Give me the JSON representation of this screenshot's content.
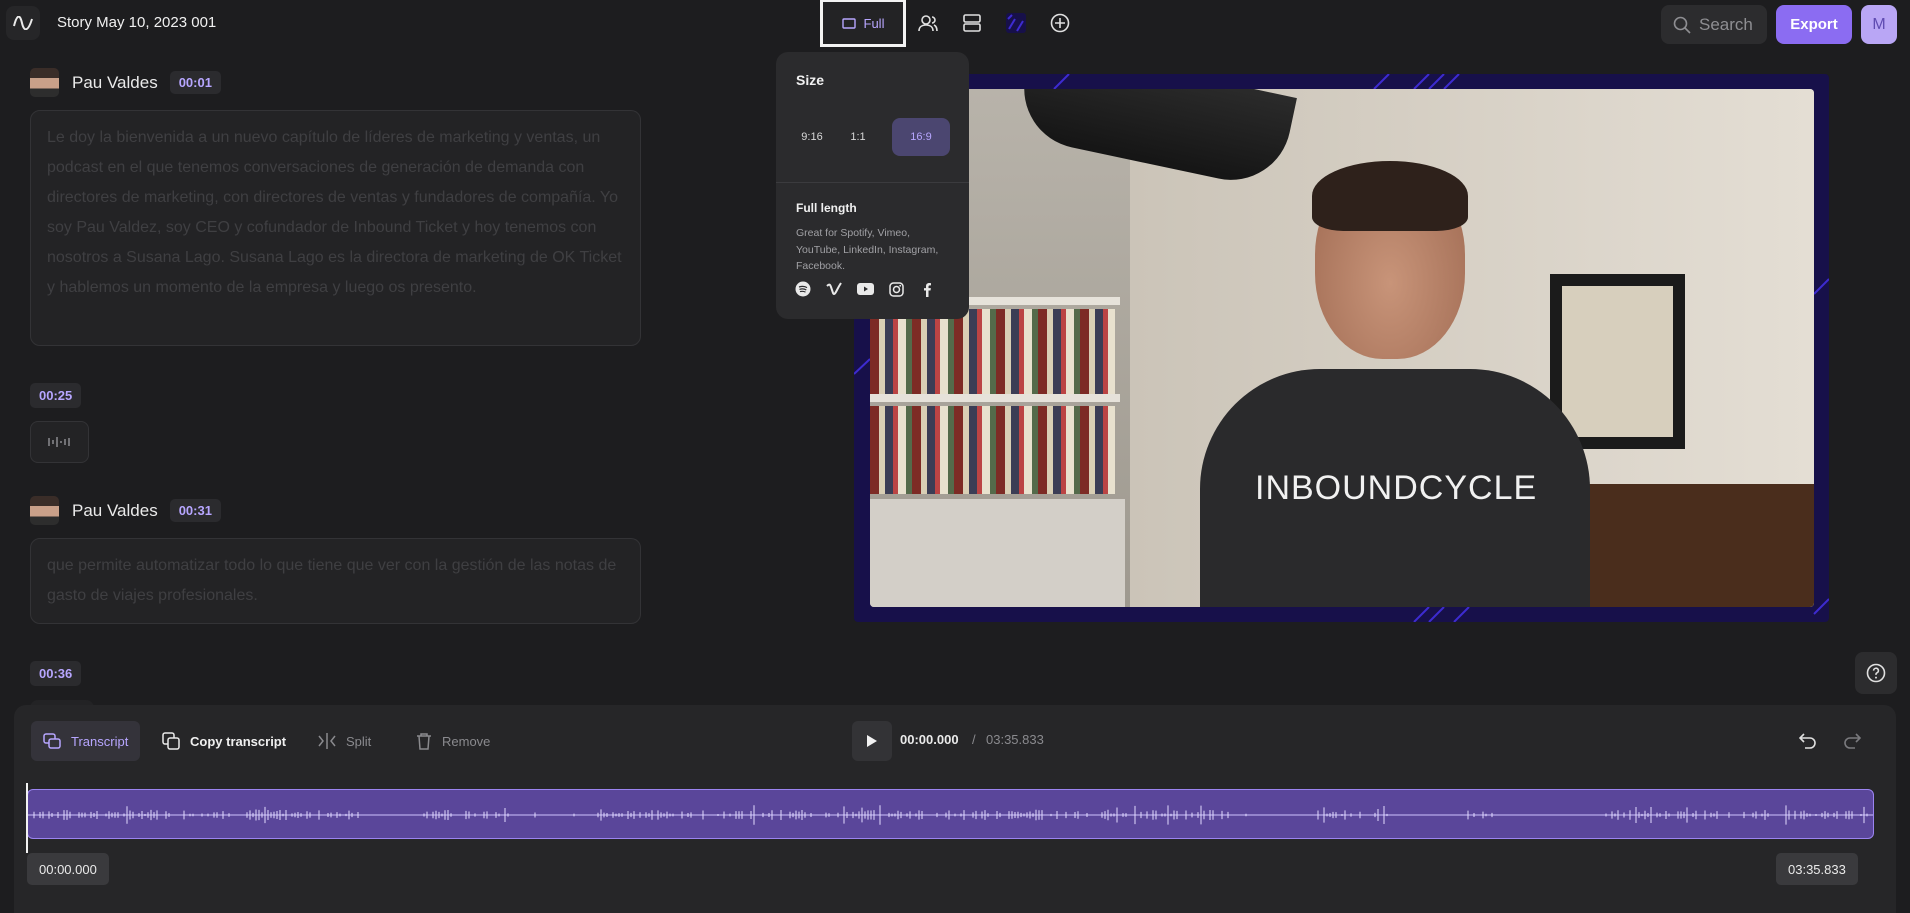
{
  "header": {
    "title": "Story May 10, 2023 001",
    "full_label": "Full",
    "search_placeholder": "Search",
    "export_label": "Export",
    "avatar_initial": "M"
  },
  "transcript": {
    "blocks": [
      {
        "speaker": "Pau Valdes",
        "time": "00:01",
        "text": "Le doy la bienvenida a un nuevo capítulo de líderes de marketing y ventas, un podcast en el que tenemos conversaciones de generación de demanda con directores de marketing, con directores de ventas y fundadores de compañía. Yo soy Pau Valdez, soy CEO y cofundador de Inbound Ticket y hoy tenemos con nosotros a Susana Lago. Susana Lago es la directora de marketing de OK Ticket y hablemos un momento de la empresa y luego os presento."
      },
      {
        "time": "00:25"
      },
      {
        "speaker": "Pau Valdes",
        "time": "00:31",
        "text": "que permite automatizar todo lo que tiene que ver con la gestión de las notas de gasto de viajes profesionales."
      },
      {
        "time": "00:36"
      }
    ]
  },
  "size_popover": {
    "title": "Size",
    "ratios": [
      "9:16",
      "1:1",
      "16:9"
    ],
    "selected": "16:9",
    "full_length_title": "Full length",
    "full_length_desc": "Great for Spotify, Vimeo, YouTube, LinkedIn, Instagram, Facebook.",
    "platforms": [
      "spotify-icon",
      "vimeo-icon",
      "youtube-icon",
      "instagram-icon",
      "facebook-icon"
    ]
  },
  "video": {
    "shirt_text": "INBOUNDCYCLE"
  },
  "toolbar": {
    "transcript_label": "Transcript",
    "copy_label": "Copy transcript",
    "split_label": "Split",
    "remove_label": "Remove",
    "current_time": "00:00.000",
    "separator": "/",
    "total_time": "03:35.833",
    "range_start": "00:00.000",
    "range_end": "03:35.833"
  },
  "colors": {
    "accent": "#8b6cf2",
    "accent_text": "#b7a6ff",
    "background": "#1d1d1f",
    "waveform": "#5a469a"
  }
}
